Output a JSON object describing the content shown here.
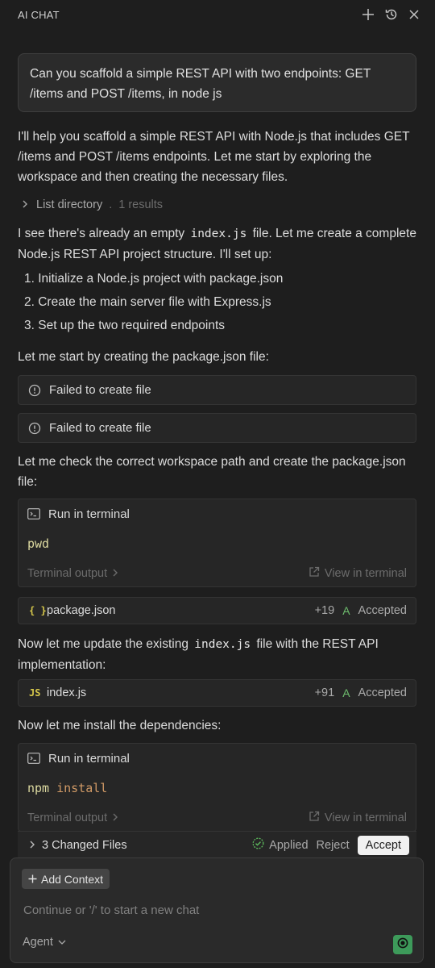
{
  "header": {
    "title": "AI CHAT",
    "icons": [
      "plus-icon",
      "history-icon",
      "close-icon"
    ]
  },
  "user_message": "Can you scaffold a simple REST API with two endpoints: GET /items and POST /items, in node js",
  "assistant": {
    "intro": "I'll help you scaffold a simple REST API with Node.js that includes GET /items and POST /items endpoints. Let me start by exploring the workspace and then creating the necessary files.",
    "list_directory": {
      "label": "List directory",
      "sep": ".",
      "count": "1 results"
    },
    "existing_pre": "I see there's already an empty",
    "existing_code": "index.js",
    "existing_post": "file. Let me create a complete Node.js REST API project structure. I'll set up:",
    "steps": [
      "1. Initialize a Node.js project with package.json",
      "2. Create the main server file with Express.js",
      "3. Set up the two required endpoints"
    ],
    "start_pkg": "Let me start by creating the package.json file:",
    "fail1": "Failed to create file",
    "fail2": "Failed to create file",
    "check_path": "Let me check the correct workspace path and create the package.json file:",
    "terminal1": {
      "label": "Run in terminal",
      "cmd": "pwd",
      "output_label": "Terminal output",
      "view_label": "View in terminal"
    },
    "file_pkg": {
      "icon_text": "{ }",
      "name": "package.json",
      "diff": "+19",
      "badge": "A",
      "status": "Accepted",
      "icon_color": "#d7c84b"
    },
    "update_pre": "Now let me update the existing",
    "update_code": "index.js",
    "update_post": "file with the REST API implementation:",
    "file_index": {
      "icon_text": "JS",
      "name": "index.js",
      "diff": "+91",
      "badge": "A",
      "status": "Accepted",
      "icon_color": "#d7c84b"
    },
    "install_text": "Now let me install the dependencies:",
    "terminal2": {
      "label": "Run in terminal",
      "cmd": "npm",
      "arg": "install",
      "output_label": "Terminal output",
      "view_label": "View in terminal"
    }
  },
  "changed_files": {
    "label": "3 Changed Files",
    "applied": "Applied",
    "reject": "Reject",
    "accept": "Accept"
  },
  "composer": {
    "add_context": "Add Context",
    "placeholder": "Continue or '/' to start a new chat",
    "mode": "Agent"
  },
  "colors": {
    "background": "#1e1e1e",
    "accent_green": "#3d9a5a",
    "accepted_green": "#6ebd6e",
    "cmd_yellow": "#dcd9a0",
    "arg_orange": "#d19a66"
  }
}
